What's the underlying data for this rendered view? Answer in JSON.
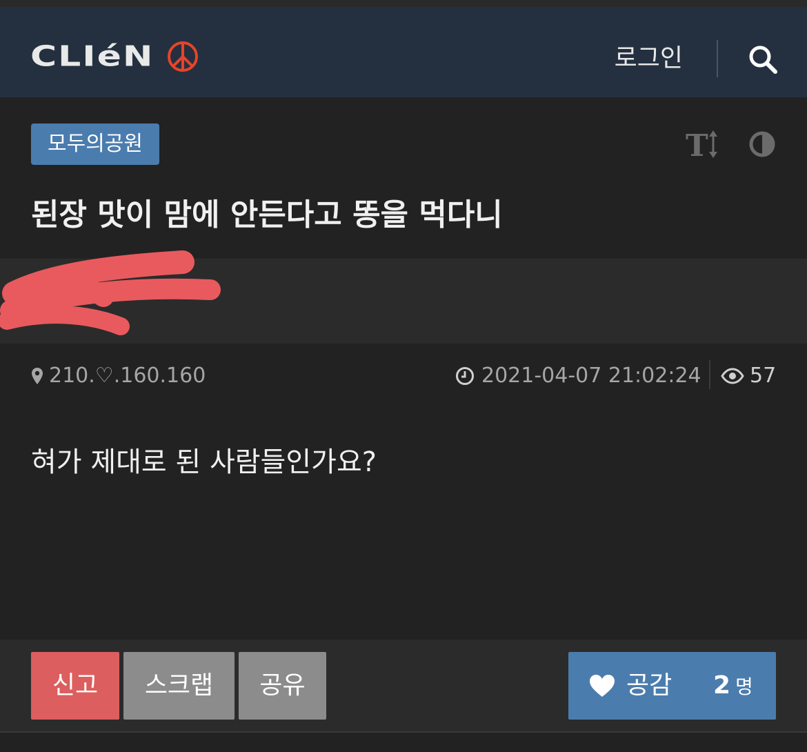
{
  "header": {
    "logo_text": "CLIéN",
    "login_label": "로그인",
    "search_icon": "search-icon",
    "colors": {
      "background": "#24303f",
      "logo_mark": "#e8432a"
    }
  },
  "post": {
    "board_tag": "모두의공원",
    "title": "된장 맛이 맘에 안든다고 똥을 먹다니",
    "ip": "210.♡.160.160",
    "timestamp": "2021-04-07 21:02:24",
    "views": "57",
    "body": "혀가 제대로 된 사람들인가요?"
  },
  "tools": {
    "font_size_icon": "text-size-icon",
    "contrast_icon": "contrast-icon"
  },
  "actions": {
    "report_label": "신고",
    "scrap_label": "스크랩",
    "share_label": "공유",
    "like_label": "공감",
    "like_count": "2",
    "like_unit": "명",
    "colors": {
      "report": "#dd5e5e",
      "neutral": "#8c8c8c",
      "like": "#4b7cae"
    }
  }
}
